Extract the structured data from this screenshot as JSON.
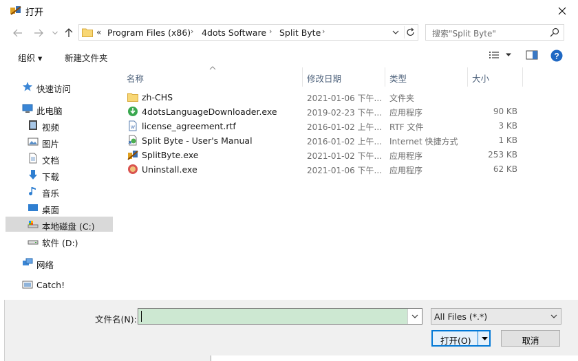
{
  "window": {
    "title": "打开"
  },
  "address": {
    "overflow": "«",
    "crumbs": [
      "Program Files (x86)",
      "4dots Software",
      "Split Byte"
    ],
    "search_placeholder": "搜索\"Split Byte\""
  },
  "toolbar": {
    "organize_label": "组织 ▾",
    "new_folder_label": "新建文件夹"
  },
  "nav_pane": {
    "items": [
      {
        "label": "快速访问",
        "icon": "star-icon"
      },
      {
        "label": "此电脑",
        "icon": "computer-icon"
      },
      {
        "label": "视频",
        "icon": "video-icon"
      },
      {
        "label": "图片",
        "icon": "pictures-icon"
      },
      {
        "label": "文档",
        "icon": "documents-icon"
      },
      {
        "label": "下载",
        "icon": "download-icon"
      },
      {
        "label": "音乐",
        "icon": "music-icon"
      },
      {
        "label": "桌面",
        "icon": "desktop-icon"
      },
      {
        "label": "本地磁盘 (C:)",
        "icon": "drive-icon"
      },
      {
        "label": "软件 (D:)",
        "icon": "drive-icon"
      },
      {
        "label": "网络",
        "icon": "network-icon"
      },
      {
        "label": "Catch!",
        "icon": "catch-icon"
      }
    ]
  },
  "columns": {
    "name": "名称",
    "date": "修改日期",
    "type": "类型",
    "size": "大小"
  },
  "files": [
    {
      "name": "zh-CHS",
      "date": "2021-01-06 下午...",
      "type": "文件夹",
      "size": "",
      "icon": "folder-icon"
    },
    {
      "name": "4dotsLanguageDownloader.exe",
      "date": "2019-02-23 下午...",
      "type": "应用程序",
      "size": "90 KB",
      "icon": "language-downloader-icon"
    },
    {
      "name": "license_agreement.rtf",
      "date": "2016-01-02 上午...",
      "type": "RTF 文件",
      "size": "3 KB",
      "icon": "rtf-file-icon"
    },
    {
      "name": "Split Byte - User's Manual",
      "date": "2016-01-02 上午...",
      "type": "Internet 快捷方式",
      "size": "1 KB",
      "icon": "internet-shortcut-icon"
    },
    {
      "name": "SplitByte.exe",
      "date": "2021-01-02 下午...",
      "type": "应用程序",
      "size": "253 KB",
      "icon": "splitbyte-app-icon"
    },
    {
      "name": "Uninstall.exe",
      "date": "2021-01-06 下午...",
      "type": "应用程序",
      "size": "62 KB",
      "icon": "uninstall-icon"
    }
  ],
  "bottom": {
    "filename_label": "文件名(N):",
    "filename_value": "",
    "filter_value": "All Files (*.*)",
    "open_label": "打开(O)",
    "cancel_label": "取消"
  },
  "colors": {
    "accent": "#0078d7",
    "selected_nav": "#d9d9d9",
    "input_bg": "#cde8d2"
  }
}
